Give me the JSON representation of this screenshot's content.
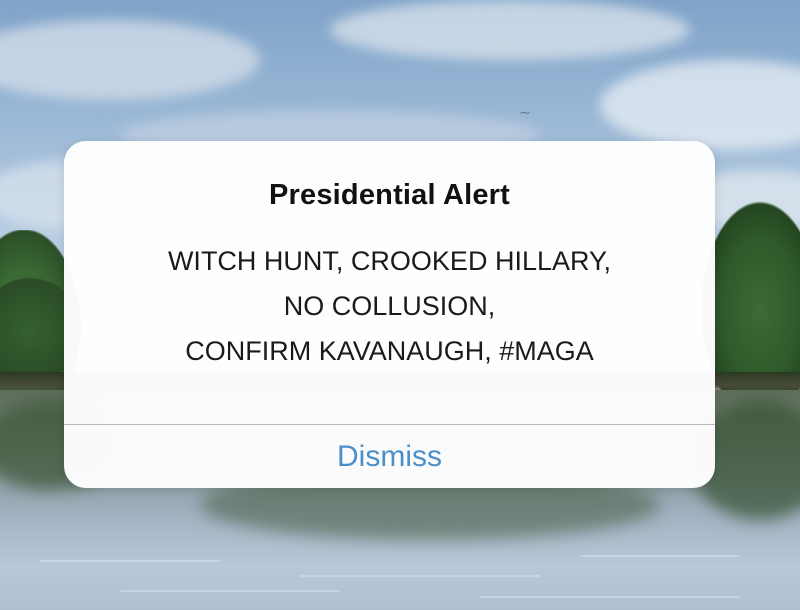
{
  "alert": {
    "title": "Presidential Alert",
    "message_lines": [
      "WITCH HUNT, CROOKED HILLARY,",
      "NO COLLUSION,",
      "CONFIRM KAVANAUGH, #MAGA"
    ],
    "dismiss_label": "Dismiss"
  },
  "colors": {
    "dismiss_text": "#4a8fc9",
    "dialog_background": "#ffffff",
    "divider": "#b9b9be"
  }
}
